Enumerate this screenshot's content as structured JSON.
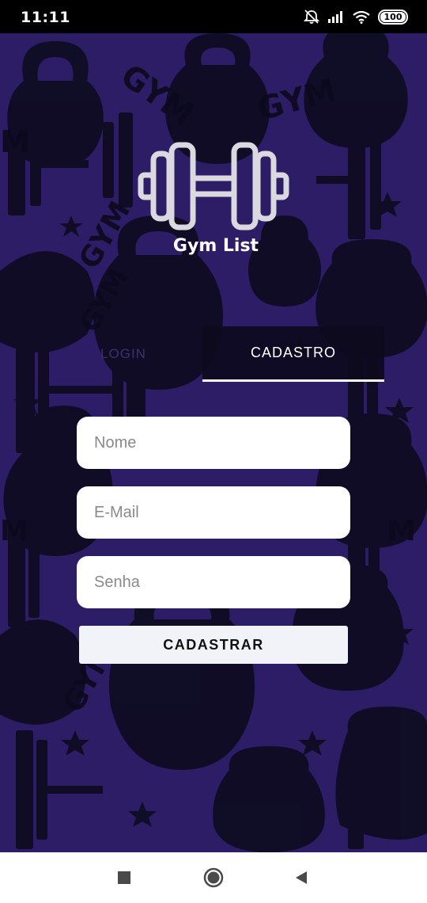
{
  "status_bar": {
    "time": "11:11",
    "battery": "100",
    "icons": [
      "alarm-off-icon",
      "signal-icon",
      "wifi-icon",
      "battery-icon"
    ]
  },
  "app": {
    "title": "Gym List",
    "tabs": [
      {
        "label": "LOGIN",
        "active": false
      },
      {
        "label": "CADASTRO",
        "active": true
      }
    ],
    "form": {
      "name_placeholder": "Nome",
      "email_placeholder": "E-Mail",
      "password_placeholder": "Senha",
      "submit_label": "CADASTRAR"
    },
    "colors": {
      "background": "#2d1d66",
      "pattern": "#0c0a1c",
      "tab_active_bg": "#0d0a1e",
      "field_bg": "#ffffff",
      "button_bg": "#f2f3f8"
    }
  },
  "nav_bar": {
    "buttons": [
      "recent-apps-icon",
      "home-icon",
      "back-icon"
    ]
  }
}
